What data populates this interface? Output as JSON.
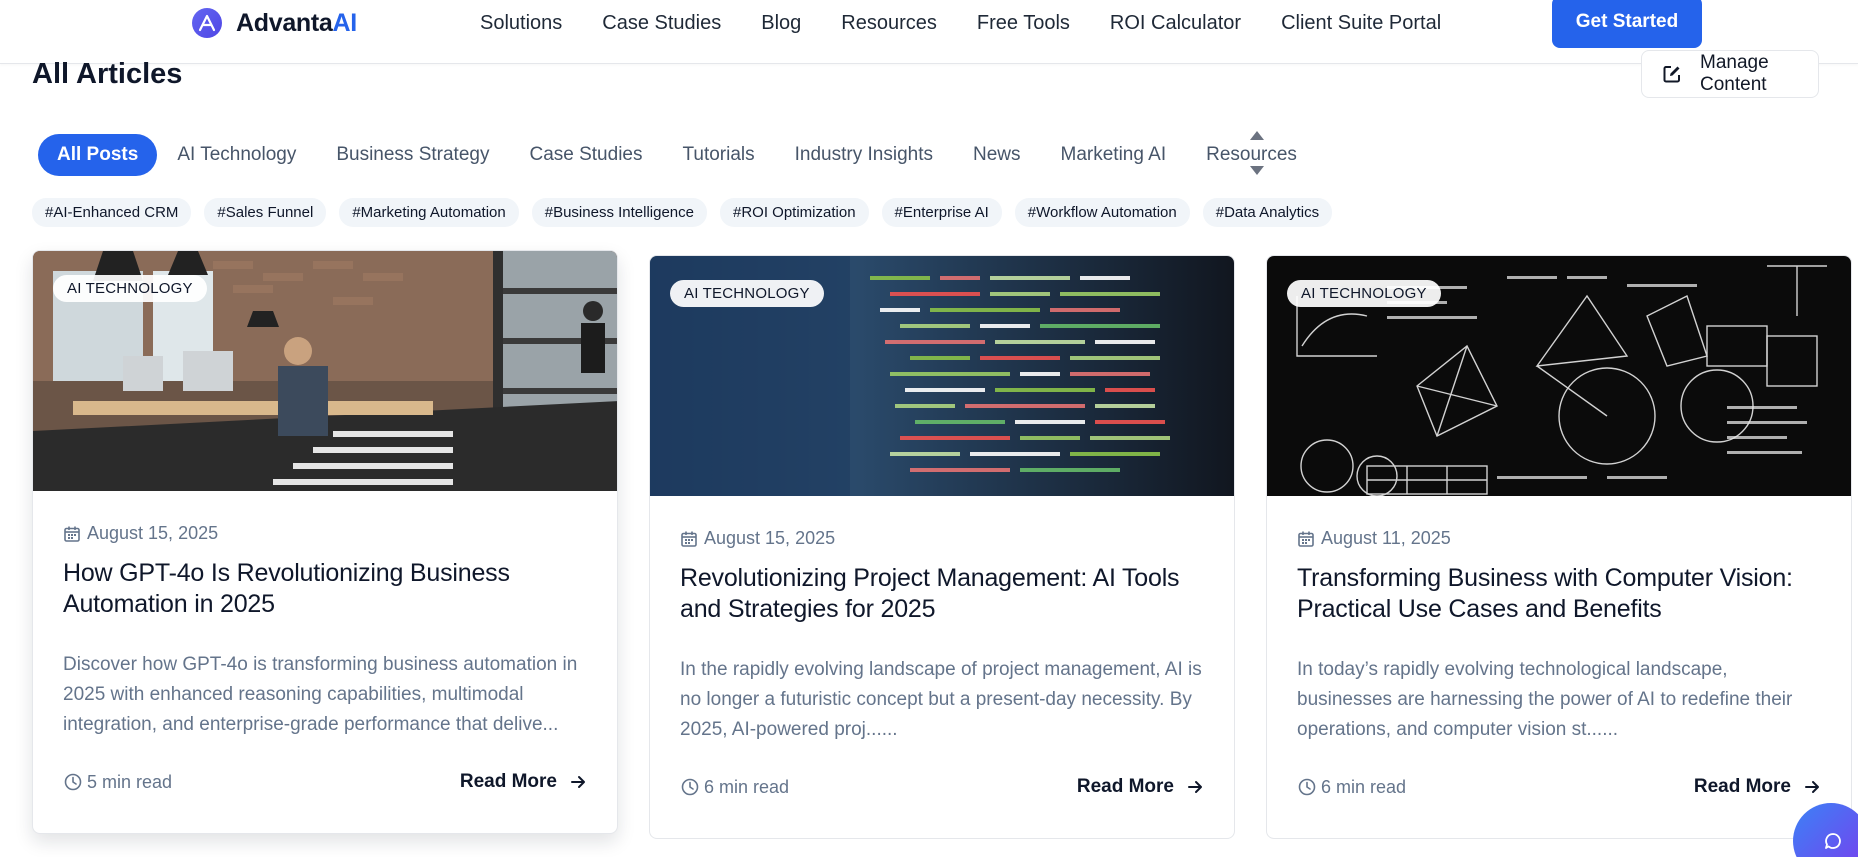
{
  "brand": {
    "name_main": "Advanta",
    "name_accent": "AI",
    "logo_icon": "advanta-logo-icon"
  },
  "nav": {
    "items": [
      "Solutions",
      "Case Studies",
      "Blog",
      "Resources",
      "Free Tools",
      "ROI Calculator",
      "Client Suite Portal"
    ],
    "cta_label": "Get Started"
  },
  "page": {
    "title": "All Articles",
    "manage_label": "Manage Content"
  },
  "categories": {
    "active": "All Posts",
    "items": [
      "All Posts",
      "AI Technology",
      "Business Strategy",
      "Case Studies",
      "Tutorials",
      "Industry Insights",
      "News",
      "Marketing AI",
      "Resources"
    ]
  },
  "tags": [
    "#AI-Enhanced CRM",
    "#Sales Funnel",
    "#Marketing Automation",
    "#Business Intelligence",
    "#ROI Optimization",
    "#Enterprise AI",
    "#Workflow Automation",
    "#Data Analytics"
  ],
  "articles": [
    {
      "badge": "AI TECHNOLOGY",
      "date": "August 15, 2025",
      "title": "How GPT-4o Is Revolutionizing Business Automation in 2025",
      "excerpt": "Discover how GPT-4o is transforming business automation in 2025 with enhanced reasoning capabilities, multimodal integration, and enterprise-grade performance that delive...",
      "read_time": "5 min read",
      "read_more": "Read More",
      "image_subject": "office-photo"
    },
    {
      "badge": "AI TECHNOLOGY",
      "date": "August 15, 2025",
      "title": "Revolutionizing Project Management: AI Tools and Strategies for 2025",
      "excerpt": "In the rapidly evolving landscape of project management, AI is no longer a futuristic concept but a present-day necessity. By 2025, AI-powered proj......",
      "read_time": "6 min read",
      "read_more": "Read More",
      "image_subject": "code-screen-photo"
    },
    {
      "badge": "AI TECHNOLOGY",
      "date": "August 11, 2025",
      "title": "Transforming Business with Computer Vision: Practical Use Cases and Benefits",
      "excerpt": "In today’s rapidly evolving technological landscape, businesses are harnessing the power of AI to redefine their operations, and computer vision st......",
      "read_time": "6 min read",
      "read_more": "Read More",
      "image_subject": "chalkboard-math-photo"
    }
  ],
  "colors": {
    "accent": "#2563eb",
    "text": "#0f172a",
    "muted": "#64748b",
    "tag_bg": "#f1f5f9"
  }
}
